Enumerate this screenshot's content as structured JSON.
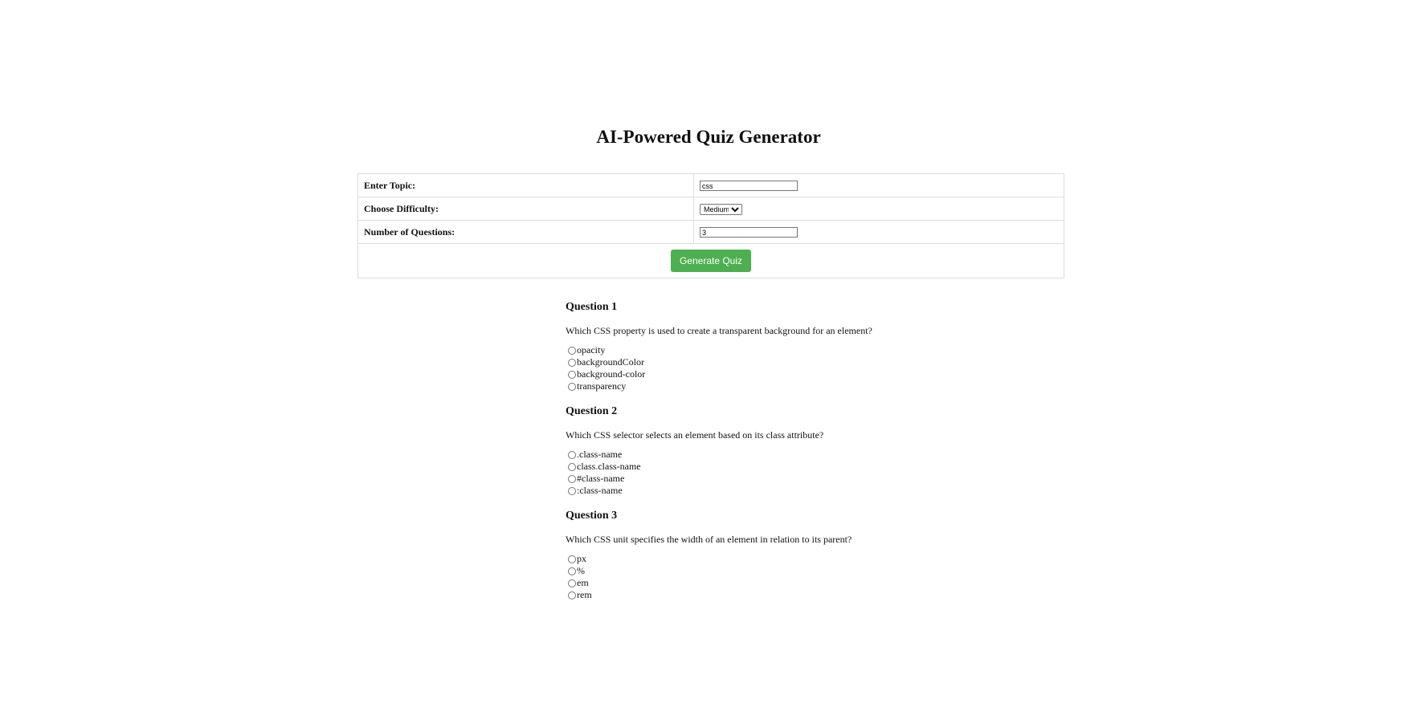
{
  "page": {
    "title": "AI-Powered Quiz Generator"
  },
  "form": {
    "topic_label": "Enter Topic:",
    "topic_value": "css",
    "difficulty_label": "Choose Difficulty:",
    "difficulty_value": "Medium",
    "count_label": "Number of Questions:",
    "count_value": "3",
    "generate_label": "Generate Quiz"
  },
  "colors": {
    "button_green": "#4caf50"
  },
  "quiz": {
    "questions": [
      {
        "title": "Question 1",
        "text": "Which CSS property is used to create a transparent background for an element?",
        "options": [
          "opacity",
          "backgroundColor",
          "background-color",
          "transparency"
        ]
      },
      {
        "title": "Question 2",
        "text": "Which CSS selector selects an element based on its class attribute?",
        "options": [
          ".class-name",
          "class.class-name",
          "#class-name",
          ":class-name"
        ]
      },
      {
        "title": "Question 3",
        "text": "Which CSS unit specifies the width of an element in relation to its parent?",
        "options": [
          "px",
          "%",
          "em",
          "rem"
        ]
      }
    ]
  }
}
